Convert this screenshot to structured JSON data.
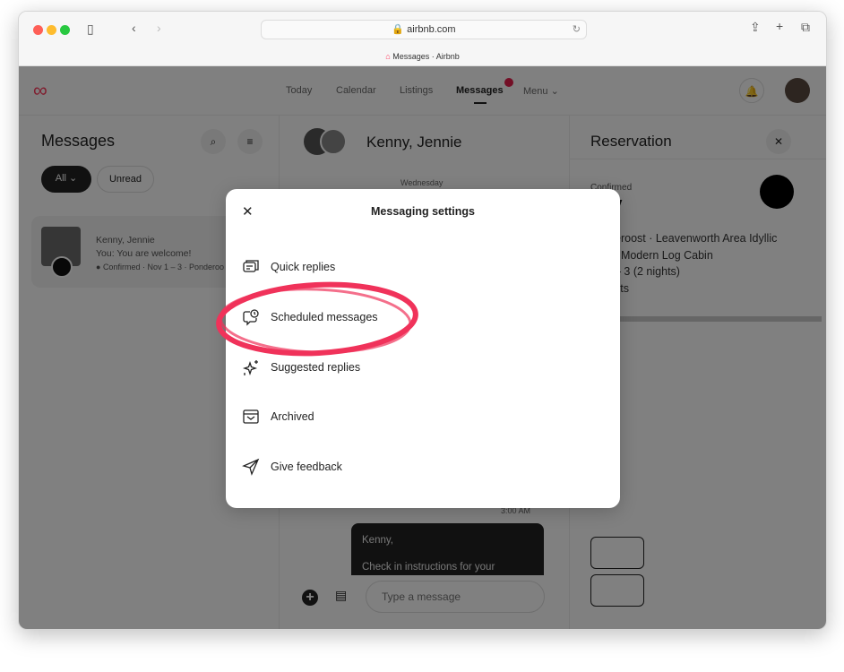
{
  "browser": {
    "url": "airbnb.com",
    "tab_title": "Messages · Airbnb"
  },
  "nav": {
    "items": [
      "Today",
      "Calendar",
      "Listings",
      "Messages",
      "Menu"
    ],
    "active": "Messages",
    "badge_color": "#e61e4d"
  },
  "left": {
    "title": "Messages",
    "filters": [
      "All",
      "Unread"
    ],
    "thread": {
      "name": "Kenny, Jennie",
      "preview": "You: You are welcome!",
      "meta": "Confirmed · Nov 1 – 3 · Ponderoo"
    }
  },
  "middle": {
    "title": "Kenny, Jennie",
    "day": "Wednesday",
    "time": "3:00 AM",
    "bubble_line1": "Kenny,",
    "bubble_line2": "Check in instructions for your",
    "input_placeholder": "Type a message"
  },
  "right": {
    "title": "Reservation",
    "status": "Confirmed",
    "guest": "nny",
    "line1": "eroost · Leavenworth Area Idyllic",
    "line2": ": Modern Log Cabin",
    "line3": "– 3 (2 nights)",
    "line4": "sts"
  },
  "modal": {
    "title": "Messaging settings",
    "items": [
      {
        "label": "Quick replies",
        "icon": "quick-replies-icon"
      },
      {
        "label": "Scheduled messages",
        "icon": "scheduled-messages-icon",
        "highlighted": true
      },
      {
        "label": "Suggested replies",
        "icon": "sparkle-icon"
      },
      {
        "label": "Archived",
        "icon": "archive-icon"
      },
      {
        "label": "Give feedback",
        "icon": "send-icon"
      }
    ],
    "highlight_color": "#f0325a"
  }
}
